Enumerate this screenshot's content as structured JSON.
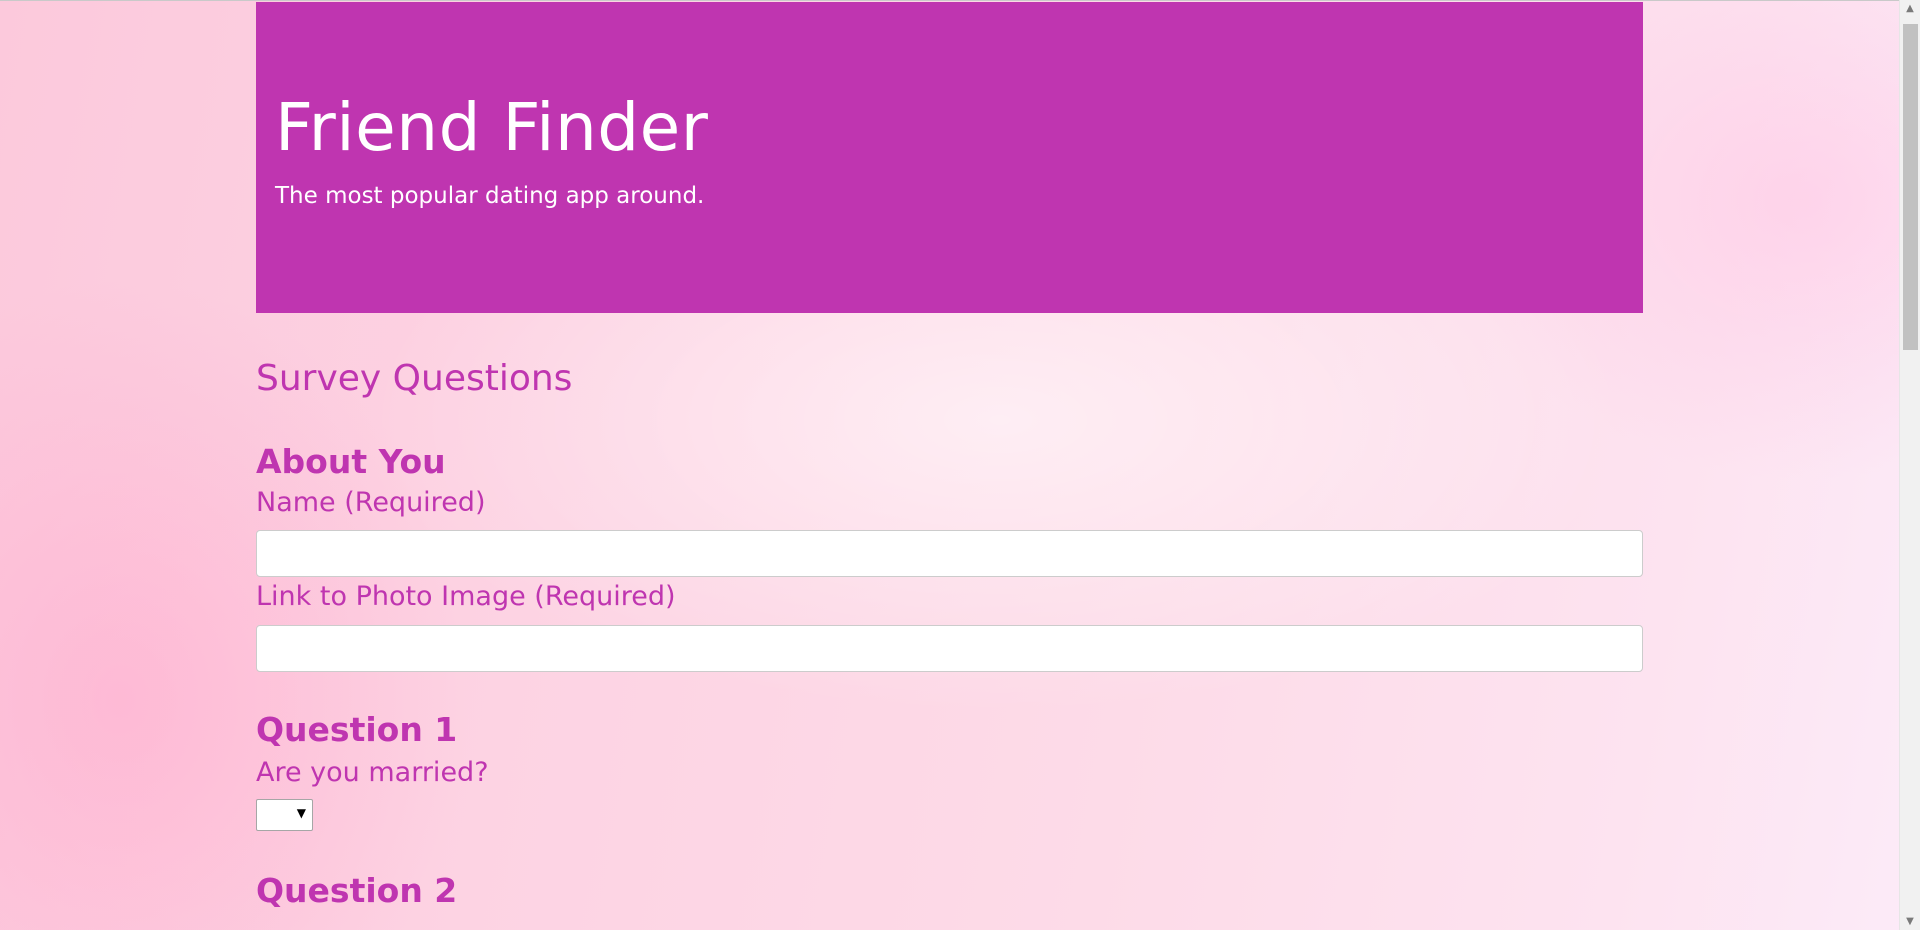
{
  "header": {
    "title": "Friend Finder",
    "subtitle": "The most popular dating app around."
  },
  "survey": {
    "title": "Survey Questions",
    "about": {
      "heading": "About You",
      "name_label": "Name (Required)",
      "name_value": "",
      "photo_label": "Link to Photo Image (Required)",
      "photo_value": ""
    },
    "questions": [
      {
        "heading": "Question 1",
        "text": "Are you married?",
        "selected": ""
      },
      {
        "heading": "Question 2"
      }
    ]
  },
  "colors": {
    "accent": "#bf35b0",
    "header_text": "#ffffff"
  },
  "icons": {
    "select_arrow": "triangle-down",
    "scroll_up": "triangle-up",
    "scroll_down": "triangle-down"
  }
}
